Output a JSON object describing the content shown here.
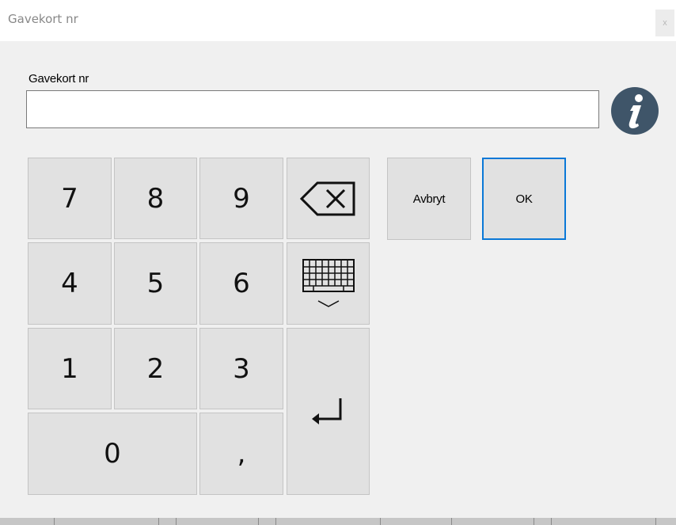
{
  "window": {
    "title": "Gavekort nr",
    "close_label": "x"
  },
  "form": {
    "label": "Gavekort nr",
    "value": "",
    "info_icon": "info-icon"
  },
  "keypad": {
    "keys": [
      "7",
      "8",
      "9",
      "4",
      "5",
      "6",
      "1",
      "2",
      "3",
      "0",
      ","
    ],
    "backspace_icon": "backspace-icon",
    "keyboard_icon": "keyboard-icon",
    "enter_icon": "enter-icon"
  },
  "actions": {
    "cancel_label": "Avbryt",
    "ok_label": "OK"
  },
  "colors": {
    "accent": "#0a78d7",
    "info_icon_bg": "#3f5569",
    "button_bg": "#e1e1e1"
  }
}
